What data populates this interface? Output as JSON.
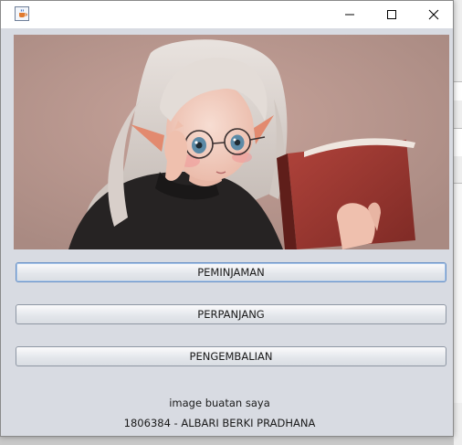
{
  "window": {
    "app_icon": "java-coffee-cup-icon",
    "controls": [
      "minimize-icon",
      "maximize-icon",
      "close-icon"
    ]
  },
  "image": {
    "description_icon": "illustration-girl-reading-book-image"
  },
  "buttons": {
    "peminjaman": "PEMINJAMAN",
    "perpanjang": "PERPANJANG",
    "pengembalian": "PENGEMBALIAN"
  },
  "footer": {
    "caption": "image buatan saya",
    "author": "1806384 - ALBARI BERKI PRADHANA"
  },
  "colors": {
    "window_bg": "#d8dbe2",
    "image_bg": "#b08f86",
    "button_border": "#8e96a3",
    "focus_border": "#6c93c6"
  }
}
